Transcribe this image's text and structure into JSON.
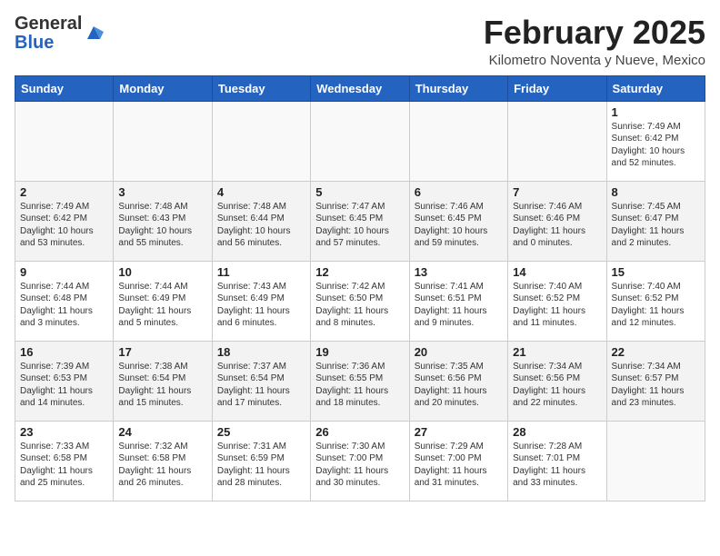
{
  "header": {
    "logo_line1": "General",
    "logo_line2": "Blue",
    "month_year": "February 2025",
    "location": "Kilometro Noventa y Nueve, Mexico"
  },
  "weekdays": [
    "Sunday",
    "Monday",
    "Tuesday",
    "Wednesday",
    "Thursday",
    "Friday",
    "Saturday"
  ],
  "weeks": [
    [
      {
        "day": "",
        "info": ""
      },
      {
        "day": "",
        "info": ""
      },
      {
        "day": "",
        "info": ""
      },
      {
        "day": "",
        "info": ""
      },
      {
        "day": "",
        "info": ""
      },
      {
        "day": "",
        "info": ""
      },
      {
        "day": "1",
        "info": "Sunrise: 7:49 AM\nSunset: 6:42 PM\nDaylight: 10 hours\nand 52 minutes."
      }
    ],
    [
      {
        "day": "2",
        "info": "Sunrise: 7:49 AM\nSunset: 6:42 PM\nDaylight: 10 hours\nand 53 minutes."
      },
      {
        "day": "3",
        "info": "Sunrise: 7:48 AM\nSunset: 6:43 PM\nDaylight: 10 hours\nand 55 minutes."
      },
      {
        "day": "4",
        "info": "Sunrise: 7:48 AM\nSunset: 6:44 PM\nDaylight: 10 hours\nand 56 minutes."
      },
      {
        "day": "5",
        "info": "Sunrise: 7:47 AM\nSunset: 6:45 PM\nDaylight: 10 hours\nand 57 minutes."
      },
      {
        "day": "6",
        "info": "Sunrise: 7:46 AM\nSunset: 6:45 PM\nDaylight: 10 hours\nand 59 minutes."
      },
      {
        "day": "7",
        "info": "Sunrise: 7:46 AM\nSunset: 6:46 PM\nDaylight: 11 hours\nand 0 minutes."
      },
      {
        "day": "8",
        "info": "Sunrise: 7:45 AM\nSunset: 6:47 PM\nDaylight: 11 hours\nand 2 minutes."
      }
    ],
    [
      {
        "day": "9",
        "info": "Sunrise: 7:44 AM\nSunset: 6:48 PM\nDaylight: 11 hours\nand 3 minutes."
      },
      {
        "day": "10",
        "info": "Sunrise: 7:44 AM\nSunset: 6:49 PM\nDaylight: 11 hours\nand 5 minutes."
      },
      {
        "day": "11",
        "info": "Sunrise: 7:43 AM\nSunset: 6:49 PM\nDaylight: 11 hours\nand 6 minutes."
      },
      {
        "day": "12",
        "info": "Sunrise: 7:42 AM\nSunset: 6:50 PM\nDaylight: 11 hours\nand 8 minutes."
      },
      {
        "day": "13",
        "info": "Sunrise: 7:41 AM\nSunset: 6:51 PM\nDaylight: 11 hours\nand 9 minutes."
      },
      {
        "day": "14",
        "info": "Sunrise: 7:40 AM\nSunset: 6:52 PM\nDaylight: 11 hours\nand 11 minutes."
      },
      {
        "day": "15",
        "info": "Sunrise: 7:40 AM\nSunset: 6:52 PM\nDaylight: 11 hours\nand 12 minutes."
      }
    ],
    [
      {
        "day": "16",
        "info": "Sunrise: 7:39 AM\nSunset: 6:53 PM\nDaylight: 11 hours\nand 14 minutes."
      },
      {
        "day": "17",
        "info": "Sunrise: 7:38 AM\nSunset: 6:54 PM\nDaylight: 11 hours\nand 15 minutes."
      },
      {
        "day": "18",
        "info": "Sunrise: 7:37 AM\nSunset: 6:54 PM\nDaylight: 11 hours\nand 17 minutes."
      },
      {
        "day": "19",
        "info": "Sunrise: 7:36 AM\nSunset: 6:55 PM\nDaylight: 11 hours\nand 18 minutes."
      },
      {
        "day": "20",
        "info": "Sunrise: 7:35 AM\nSunset: 6:56 PM\nDaylight: 11 hours\nand 20 minutes."
      },
      {
        "day": "21",
        "info": "Sunrise: 7:34 AM\nSunset: 6:56 PM\nDaylight: 11 hours\nand 22 minutes."
      },
      {
        "day": "22",
        "info": "Sunrise: 7:34 AM\nSunset: 6:57 PM\nDaylight: 11 hours\nand 23 minutes."
      }
    ],
    [
      {
        "day": "23",
        "info": "Sunrise: 7:33 AM\nSunset: 6:58 PM\nDaylight: 11 hours\nand 25 minutes."
      },
      {
        "day": "24",
        "info": "Sunrise: 7:32 AM\nSunset: 6:58 PM\nDaylight: 11 hours\nand 26 minutes."
      },
      {
        "day": "25",
        "info": "Sunrise: 7:31 AM\nSunset: 6:59 PM\nDaylight: 11 hours\nand 28 minutes."
      },
      {
        "day": "26",
        "info": "Sunrise: 7:30 AM\nSunset: 7:00 PM\nDaylight: 11 hours\nand 30 minutes."
      },
      {
        "day": "27",
        "info": "Sunrise: 7:29 AM\nSunset: 7:00 PM\nDaylight: 11 hours\nand 31 minutes."
      },
      {
        "day": "28",
        "info": "Sunrise: 7:28 AM\nSunset: 7:01 PM\nDaylight: 11 hours\nand 33 minutes."
      },
      {
        "day": "",
        "info": ""
      }
    ]
  ]
}
